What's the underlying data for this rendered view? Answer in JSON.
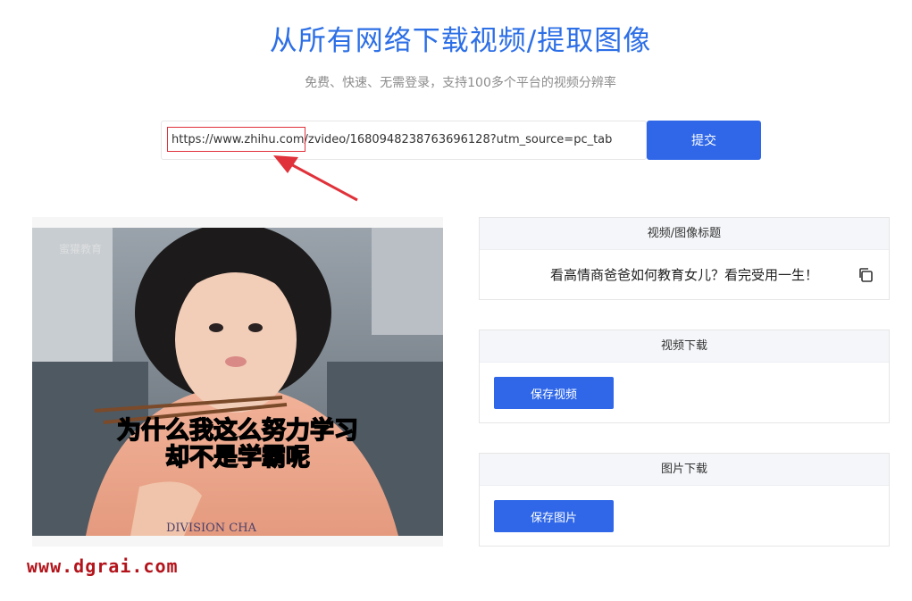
{
  "header": {
    "title": "从所有网络下载视频/提取图像",
    "subtitle": "免费、快速、无需登录，支持100多个平台的视频分辨率"
  },
  "form": {
    "url_value": "https://www.zhihu.com/zvideo/1680948238763696128?utm_source=pc_tab",
    "submit_label": "提交"
  },
  "preview": {
    "caption_line1": "为什么我这么努力学习",
    "caption_line2": "却不是学霸呢",
    "corner_logo": "蜜獾教育",
    "shirt_text": "DIVISION CHA"
  },
  "panels": {
    "title_panel": {
      "header": "视频/图像标题",
      "value": "看高情商爸爸如何教育女儿？看完受用一生！"
    },
    "video_panel": {
      "header": "视频下载",
      "button": "保存视频"
    },
    "image_panel": {
      "header": "图片下载",
      "button": "保存图片"
    }
  },
  "watermark": "www.dgrai.com",
  "colors": {
    "accent": "#2f67e8",
    "title": "#2d6fe6",
    "highlight": "#e0323a",
    "watermark": "#b3141b"
  }
}
